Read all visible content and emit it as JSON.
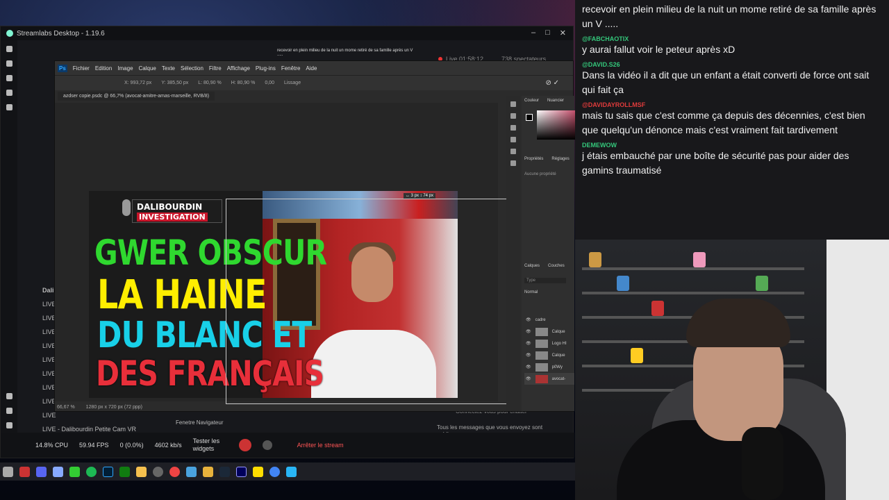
{
  "streamlabs": {
    "title": "Streamlabs Desktop - 1.19.6",
    "live_time": "Live 01:58:12",
    "viewers": "738 spectateurs",
    "preview_text": "recevoir en plein milieu de la nuit un mome retiré de sa famille après un V .....",
    "scene_header": "Dali",
    "scenes": [
      "LIVE",
      "LIVE",
      "LIVE",
      "LIVE",
      "LIVE",
      "LIVE",
      "LIVE",
      "LIVE",
      "LIVE",
      "LIVE - Dalibourdin Petite Cam VR"
    ],
    "source": "Fenetre Navigateur",
    "cpu": "14.8% CPU",
    "fps": "59.94 FPS",
    "dropped": "0 (0.0%)",
    "bitrate": "4602 kb/s",
    "test_widgets": "Tester les widgets",
    "stop_stream": "Arrêter le stream",
    "chat_placeholder": "Connectez-vous pour chatter",
    "chat_note": "Tous les messages que vous envoyez sont publics"
  },
  "photoshop": {
    "menu": [
      "Fichier",
      "Edition",
      "Image",
      "Calque",
      "Texte",
      "Sélection",
      "Filtre",
      "Affichage",
      "Plug-ins",
      "Fenêtre",
      "Aide"
    ],
    "logo": "Ps",
    "options": {
      "x": "X: 993,72 px",
      "y": "Y: 385,50 px",
      "w": "L: 80,90 %",
      "h": "H: 80,90 %",
      "angle": "0,00",
      "interp": "Lissage"
    },
    "tab": "azdser copie.psdc @ 66,7% (avocat-amitre-amas-marseille, RVB/8)",
    "status_zoom": "66,67 %",
    "status_size": "1280 px x 720 px (72 ppp)",
    "transform_tip": "↔ 3 px ↕ 74 px",
    "panels": {
      "color": "Couleur",
      "swatches": "Nuancier",
      "props": "Propriétés",
      "adjust": "Réglages",
      "no_props": "Aucune propriété",
      "layers": "Calques",
      "channels": "Couches",
      "blend": "Normal",
      "search": "Type",
      "group": "cadre"
    },
    "layers": [
      "Calque",
      "Logo HI",
      "Calque",
      "p0Wy",
      "avocat-"
    ]
  },
  "thumbnail": {
    "brand1": "DALIBOURDIN",
    "brand2": "INVESTIGATION",
    "line1": "GWER OBSCUR",
    "line2": "LA HAINE",
    "line3": "DU BLANC ET",
    "line4": "DES FRANÇAIS"
  },
  "chat": [
    {
      "user": "",
      "text": "recevoir en plein milieu de la nuit un mome retiré de sa famille après un V .....",
      "color": "#34c77b"
    },
    {
      "user": "@FABCHAOTIX",
      "text": "y aurai fallut voir le peteur après xD",
      "color": "#34c77b"
    },
    {
      "user": "@DAVID.S26",
      "text": "Dans la vidéo il a dit que un enfant a était converti de force ont sait qui fait ça",
      "color": "#34c77b"
    },
    {
      "user": "@DAVIDAYROLLMSF",
      "text": "mais tu sais que c'est comme ça depuis des décennies, c'est bien que quelqu'un dénonce mais c'est vraiment fait tardivement",
      "color": "#e03b3b"
    },
    {
      "user": "DEMEWOW",
      "text": "j étais embauché par une boîte de sécurité pas pour aider des gamins traumatisé",
      "color": "#34c77b"
    }
  ],
  "taskbar_icons": [
    "folder-icon",
    "app-icon",
    "discord-icon",
    "privacy-icon",
    "xbox-gamebar-icon",
    "spotify-icon",
    "photoshop-icon",
    "xbox-icon",
    "explorer-icon",
    "settings-icon",
    "chrome-icon",
    "photos-icon",
    "folder2-icon",
    "steam-icon",
    "premiere-icon",
    "notes-icon",
    "chrome2-icon",
    "app2-icon"
  ]
}
